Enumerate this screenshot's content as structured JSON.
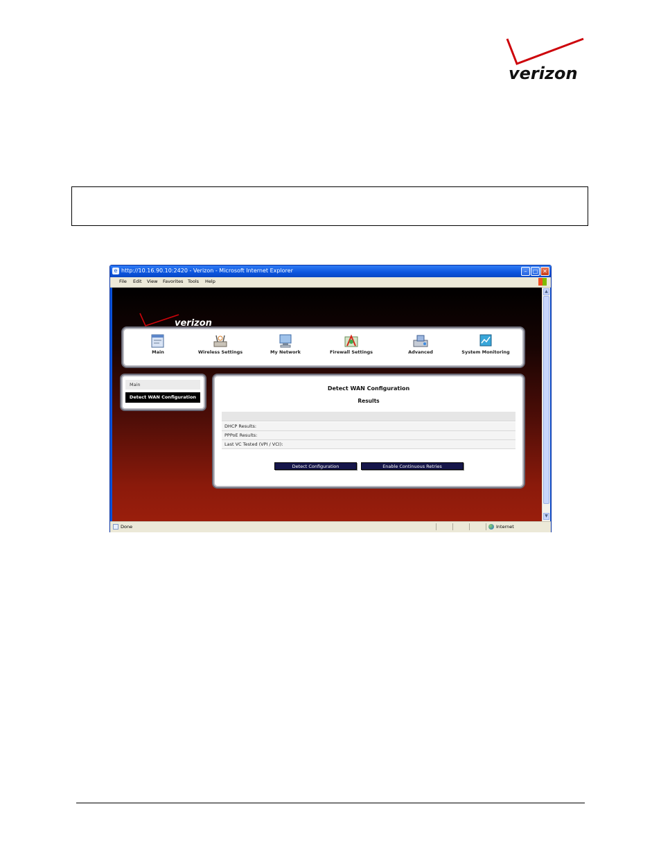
{
  "colors": {
    "brand_red": "#cd040b",
    "xp_blue": "#0b55de",
    "button_navy": "#16164a"
  },
  "logo_text": "verizon",
  "browser": {
    "title": "http://10.16.90.10:2420 - Verizon - Microsoft Internet Explorer",
    "window_buttons": [
      "minimize-icon",
      "maximize-icon",
      "close-icon"
    ],
    "menu": [
      "File",
      "Edit",
      "View",
      "Favorites",
      "Tools",
      "Help"
    ],
    "status_left": "Done",
    "status_zone": "Internet"
  },
  "page": {
    "logo_text": "verizon",
    "nav": [
      {
        "label": "Main",
        "icon": "main-icon"
      },
      {
        "label": "Wireless Settings",
        "icon": "wireless-icon"
      },
      {
        "label": "My Network",
        "icon": "network-icon"
      },
      {
        "label": "Firewall Settings",
        "icon": "firewall-icon"
      },
      {
        "label": "Advanced",
        "icon": "advanced-icon"
      },
      {
        "label": "System Monitoring",
        "icon": "monitor-icon"
      }
    ],
    "left_menu": {
      "main": "Main",
      "active": "Detect WAN Configuration"
    },
    "panel": {
      "title": "Detect WAN Configuration",
      "subtitle": "Results",
      "rows": [
        "DHCP Results:",
        "PPPoE Results:",
        "Last VC Tested (VPI / VCI):"
      ],
      "buttons": {
        "detect": "Detect Configuration",
        "retry": "Enable Continuous Retries"
      }
    }
  }
}
